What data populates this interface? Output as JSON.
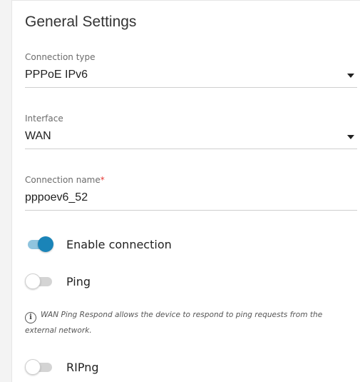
{
  "header": {
    "title": "General Settings"
  },
  "fields": {
    "connection_type": {
      "label": "Connection type",
      "value": "PPPoE IPv6"
    },
    "interface": {
      "label": "Interface",
      "value": "WAN"
    },
    "connection_name": {
      "label": "Connection name",
      "required_mark": "*",
      "value": "pppoev6_52"
    }
  },
  "toggles": {
    "enable_connection": {
      "label": "Enable connection",
      "state": "on"
    },
    "ping": {
      "label": "Ping",
      "state": "off"
    },
    "ripng": {
      "label": "RIPng",
      "state": "off"
    }
  },
  "info": {
    "icon": "info-icon",
    "glyph": "i",
    "text": "WAN Ping Respond allows the device to respond to ping requests from the external network."
  },
  "colors": {
    "accent": "#1a84b8",
    "accent_track": "#8fc4de",
    "required": "#e53935"
  }
}
